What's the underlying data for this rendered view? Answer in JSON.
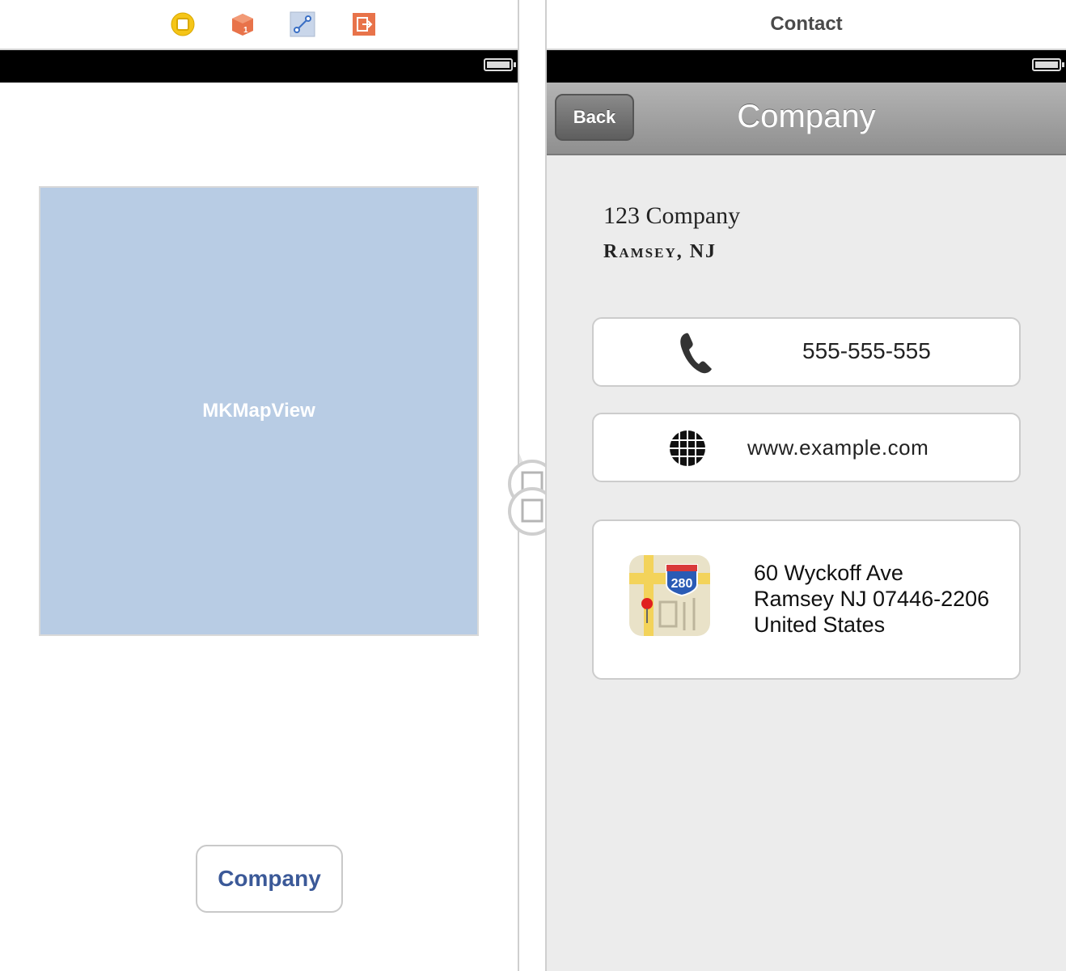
{
  "left_scene": {
    "dock_icons": [
      {
        "name": "view-controller-icon",
        "color": "#f5c518"
      },
      {
        "name": "first-responder-icon",
        "color": "#e8734a"
      },
      {
        "name": "segue-icon",
        "color": "#5a8fd6"
      },
      {
        "name": "exit-icon",
        "color": "#e8734a"
      }
    ],
    "map_view_label": "MKMapView",
    "company_button_label": "Company"
  },
  "right_scene": {
    "scene_title": "Contact",
    "nav": {
      "back_label": "Back",
      "title": "Company"
    },
    "company_name": "123 Company",
    "company_city": "Ramsey, NJ",
    "phone": "555-555-555",
    "website": "www.example.com",
    "address": {
      "line1": "60 Wyckoff Ave",
      "line2": "Ramsey NJ 07446-2206",
      "line3": "United States"
    },
    "map_icon_route": "280"
  }
}
